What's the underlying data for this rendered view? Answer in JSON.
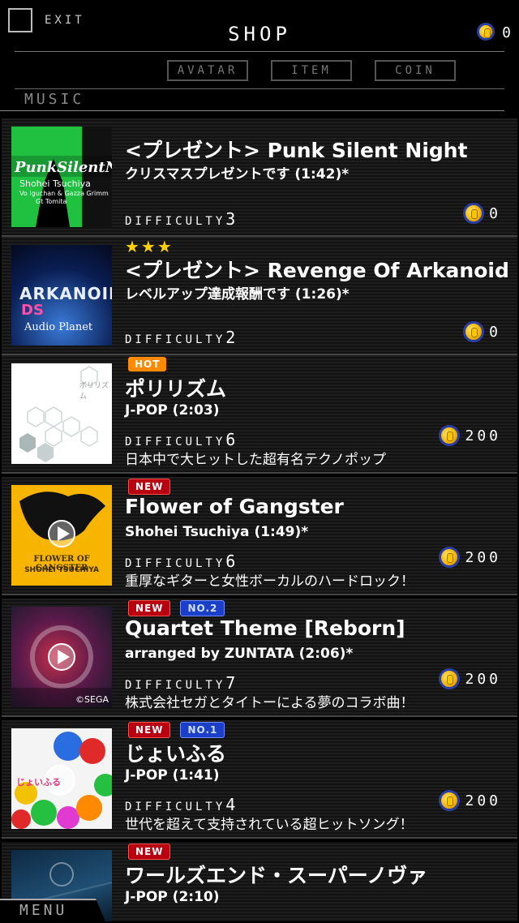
{
  "header": {
    "exit_label": "EXIT",
    "title": "SHOP",
    "coin_balance": "0",
    "tabs": [
      "AVATAR",
      "ITEM",
      "COIN"
    ],
    "section": "MUSIC"
  },
  "songs": [
    {
      "title": "<プレゼント> Punk Silent Night",
      "subtitle": "クリスマスプレゼントです (1:42)*",
      "difficulty_label": "DIFFICULTY",
      "difficulty": "3",
      "price": "0",
      "thumb_text": "Shohei Tsuchiya",
      "thumb_text2": "Vo Iguchan & Gazza Grimm",
      "thumb_text3": "Gt Tomita"
    },
    {
      "stars": "★★★",
      "title": "<プレゼント> Revenge Of Arkanoid",
      "subtitle": "レベルアップ達成報酬です (1:26)*",
      "difficulty_label": "DIFFICULTY",
      "difficulty": "2",
      "price": "0",
      "thumb_text": "ARKANOID",
      "thumb_text2": "DS",
      "thumb_text3": "Audio Planet"
    },
    {
      "badges": [
        "HOT"
      ],
      "title": "ポリリズム",
      "subtitle": "J-POP (2:03)",
      "difficulty_label": "DIFFICULTY",
      "difficulty": "6",
      "price": "200",
      "description": "日本中で大ヒットした超有名テクノポップ",
      "thumb_text": "ポリリズム"
    },
    {
      "badges": [
        "NEW"
      ],
      "title": "Flower of Gangster",
      "subtitle": "Shohei Tsuchiya (1:49)*",
      "difficulty_label": "DIFFICULTY",
      "difficulty": "6",
      "price": "200",
      "description": "重厚なギターと女性ボーカルのハードロック！",
      "thumb_text": "FLOWER OF GANGSTER",
      "thumb_text2": "SHOHEI TSUCHIYA"
    },
    {
      "badges": [
        "NEW",
        "NO.2"
      ],
      "title": "Quartet Theme [Reborn]",
      "subtitle": "arranged by ZUNTATA (2:06)*",
      "difficulty_label": "DIFFICULTY",
      "difficulty": "7",
      "price": "200",
      "description": "株式会社セガとタイトーによる夢のコラボ曲！",
      "thumb_text": "©SEGA"
    },
    {
      "badges": [
        "NEW",
        "NO.1"
      ],
      "title": "じょいふる",
      "subtitle": "J-POP (1:41)",
      "difficulty_label": "DIFFICULTY",
      "difficulty": "4",
      "price": "200",
      "description": "世代を超えて支持されている超ヒットソング！",
      "thumb_text": "じょいふる"
    },
    {
      "badges": [
        "NEW"
      ],
      "title": "ワールズエンド・スーパーノヴァ",
      "subtitle": "J-POP (2:10)"
    }
  ],
  "menu_label": "MENU"
}
